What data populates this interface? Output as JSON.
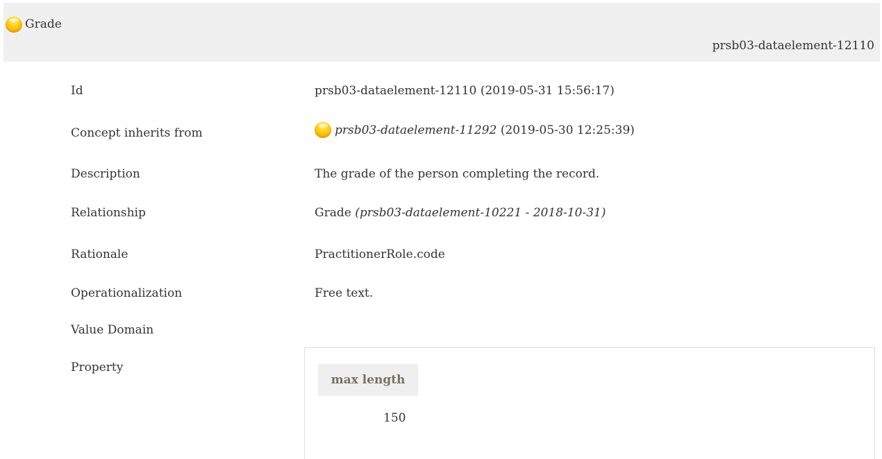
{
  "header": {
    "title": "Grade",
    "id": "prsb03-dataelement-12110",
    "icon": "concept-orb-icon",
    "background": "#f0f0f0"
  },
  "details": {
    "id": {
      "label": "Id",
      "value": "prsb03-dataelement-12110 (2019-05-31 15:56:17)"
    },
    "inherits": {
      "label": "Concept inherits from",
      "link": "prsb03-dataelement-11292",
      "date": "(2019-05-30 12:25:39)",
      "icon": "concept-orb-icon"
    },
    "description": {
      "label": "Description",
      "value": "The grade of the person completing the record."
    },
    "relationship": {
      "label": "Relationship",
      "value": "Grade",
      "ref": "(prsb03-dataelement-10221 - 2018-10-31)"
    },
    "rationale": {
      "label": "Rationale",
      "value": "PractitionerRole.code"
    },
    "operationalization": {
      "label": "Operationalization",
      "value": "Free text."
    },
    "value_domain": {
      "label": "Value Domain"
    },
    "property": {
      "label": "Property",
      "header": "max length",
      "value": "150"
    }
  },
  "colors": {
    "text": "#333333",
    "muted_header": "#777160",
    "orb": "#ffd21a"
  }
}
